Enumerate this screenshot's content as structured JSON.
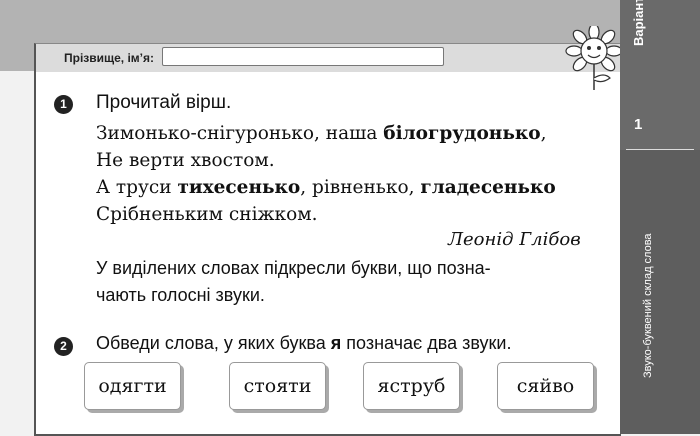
{
  "header": {
    "name_label": "Прізвище, ім’я:",
    "name_value": ""
  },
  "side": {
    "variant_label": "Варіант",
    "variant_mark": "1",
    "variant_number": "1",
    "topic": "Звуко-буквений склад слова"
  },
  "task1": {
    "number": "1",
    "title": "Прочитай вірш.",
    "poem": [
      [
        "Зимонько-снігуронько, наша ",
        {
          "b": "білогрудонько"
        },
        ","
      ],
      [
        "Не верти хвостом."
      ],
      [
        "А труси ",
        {
          "b": "тихесенько"
        },
        ", рівненько, ",
        {
          "b": "гладесенько"
        }
      ],
      [
        "Срібненьким сніжком."
      ]
    ],
    "author": "Леонід Глібов",
    "instruction_line1": "У виділених словах підкресли букви, що позна-",
    "instruction_line2": "чають голосні звуки."
  },
  "task2": {
    "number": "2",
    "text_before": "Обведи слова, у яких буква ",
    "letter": "я",
    "text_after": " позначає два звуки.",
    "words": [
      "одягти",
      "стояти",
      "яструб",
      "сяйво"
    ]
  }
}
